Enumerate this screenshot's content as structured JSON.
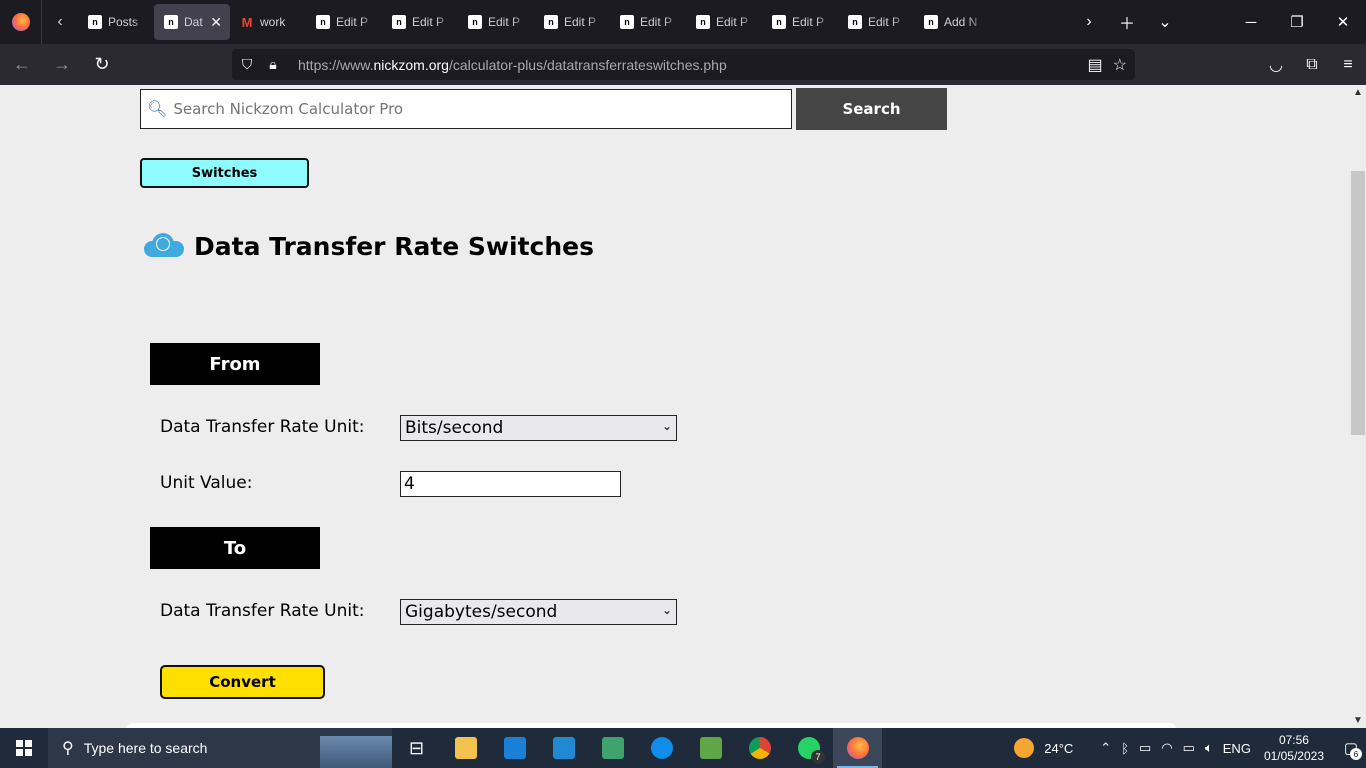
{
  "browser": {
    "tabs": [
      {
        "label": "Posts",
        "favicon": "nz-icon"
      },
      {
        "label": "Dat",
        "favicon": "nz-icon",
        "active": true
      },
      {
        "label": "work",
        "favicon": "gmail-icon"
      },
      {
        "label": "Edit P",
        "favicon": "nz-icon"
      },
      {
        "label": "Edit P",
        "favicon": "nz-icon"
      },
      {
        "label": "Edit P",
        "favicon": "nz-icon"
      },
      {
        "label": "Edit P",
        "favicon": "nz-icon"
      },
      {
        "label": "Edit P",
        "favicon": "nz-icon"
      },
      {
        "label": "Edit P",
        "favicon": "nz-icon"
      },
      {
        "label": "Edit P",
        "favicon": "nz-icon"
      },
      {
        "label": "Edit P",
        "favicon": "nz-icon"
      },
      {
        "label": "Add N",
        "favicon": "nz-icon"
      }
    ],
    "url_prefix": "https://www.",
    "url_domain": "nickzom.org",
    "url_path": "/calculator-plus/datatransferrateswitches.php"
  },
  "search": {
    "placeholder": "Search Nickzom Calculator Pro",
    "button_label": "Search"
  },
  "switches_label": "Switches",
  "page_title": "Data Transfer Rate Switches",
  "from": {
    "heading": "From",
    "unit_label": "Data Transfer Rate Unit:",
    "unit_value": "Bits/second",
    "value_label": "Unit Value:",
    "value": "4"
  },
  "to": {
    "heading": "To",
    "unit_label": "Data Transfer Rate Unit:",
    "unit_value": "Gigabytes/second"
  },
  "convert_label": "Convert",
  "taskbar": {
    "search_placeholder": "Type here to search",
    "whatsapp_badge": "7",
    "temperature": "24°C",
    "language": "ENG",
    "time": "07:56",
    "date": "01/05/2023",
    "notifications": "6"
  }
}
